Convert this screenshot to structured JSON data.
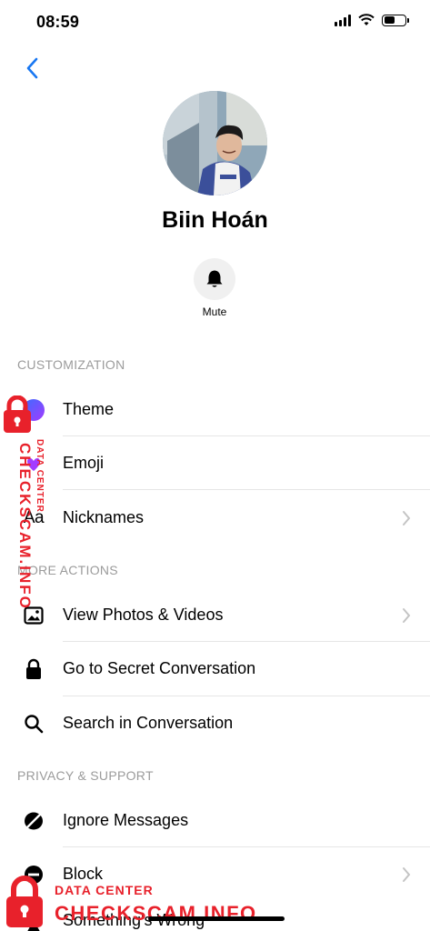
{
  "status_bar": {
    "time": "08:59"
  },
  "profile": {
    "name": "Biin Hoán"
  },
  "actions": {
    "mute_label": "Mute"
  },
  "sections": [
    {
      "header": "CUSTOMIZATION",
      "items": [
        {
          "label": "Theme",
          "icon": "theme-color-icon"
        },
        {
          "label": "Emoji",
          "icon": "emoji-icon"
        },
        {
          "label": "Nicknames",
          "icon": "text-aa-icon",
          "icon_text": "Aa"
        }
      ]
    },
    {
      "header": "MORE ACTIONS",
      "items": [
        {
          "label": "View Photos & Videos",
          "icon": "photo-icon"
        },
        {
          "label": "Go to Secret Conversation",
          "icon": "lock-icon"
        },
        {
          "label": "Search in Conversation",
          "icon": "search-icon"
        }
      ]
    },
    {
      "header": "PRIVACY & SUPPORT",
      "items": [
        {
          "label": "Ignore Messages",
          "icon": "ignore-icon"
        },
        {
          "label": "Block",
          "icon": "block-icon"
        },
        {
          "label": "Something's Wrong",
          "icon": "warning-icon"
        }
      ]
    }
  ],
  "watermark": {
    "small": "DATA CENTER",
    "big": "CHECKSCAM.INFO"
  },
  "colors": {
    "accent": "#1877f2",
    "theme_gradient_start": "#3b6cff",
    "theme_gradient_end": "#a33bff",
    "watermark": "#e8212b",
    "section_header": "#9b9b9b"
  }
}
